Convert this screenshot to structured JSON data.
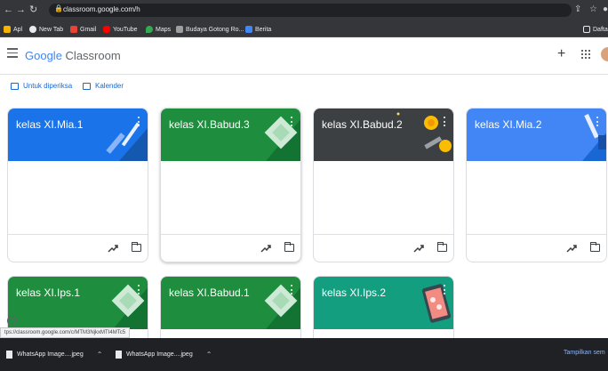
{
  "browser": {
    "url": "classroom.google.com/h",
    "bookmarks": [
      {
        "label": "Apl",
        "color": "#f4b400"
      },
      {
        "label": "New Tab",
        "color": "#e8eaed"
      },
      {
        "label": "Gmail",
        "color": "#ea4335"
      },
      {
        "label": "YouTube",
        "color": "#ff0000"
      },
      {
        "label": "Maps",
        "color": "#34a853"
      },
      {
        "label": "Budaya Gotong Ro...",
        "color": "#9e9e9e"
      },
      {
        "label": "Berita",
        "color": "#4285f4"
      }
    ],
    "reading_list": "Dafta"
  },
  "header": {
    "logo_google": "Google",
    "logo_product": "Classroom"
  },
  "subnav": {
    "to_review": "Untuk diperiksa",
    "calendar": "Kalender"
  },
  "classes": [
    {
      "title": "kelas XI.Mia.1",
      "color": "#1a73e8"
    },
    {
      "title": "kelas XI.Babud.3",
      "color": "#1e8e3e"
    },
    {
      "title": "kelas XI.Babud.2",
      "color": "#3c4043"
    },
    {
      "title": "kelas XI.Mia.2",
      "color": "#4285f4"
    },
    {
      "title": "kelas XI.Ips.1",
      "color": "#1e8e3e"
    },
    {
      "title": "kelas XI.Babud.1",
      "color": "#1e8e3e"
    },
    {
      "title": "kelas XI.Ips.2",
      "color": "#129e7f"
    }
  ],
  "status_url": "tps://classroom.google.com/c/MTM3NjkxMTI4MTc5",
  "downloads": [
    {
      "name": "WhatsApp Image....jpeg"
    },
    {
      "name": "WhatsApp Image....jpeg"
    }
  ],
  "download_show_all": "Tampilkan sem"
}
